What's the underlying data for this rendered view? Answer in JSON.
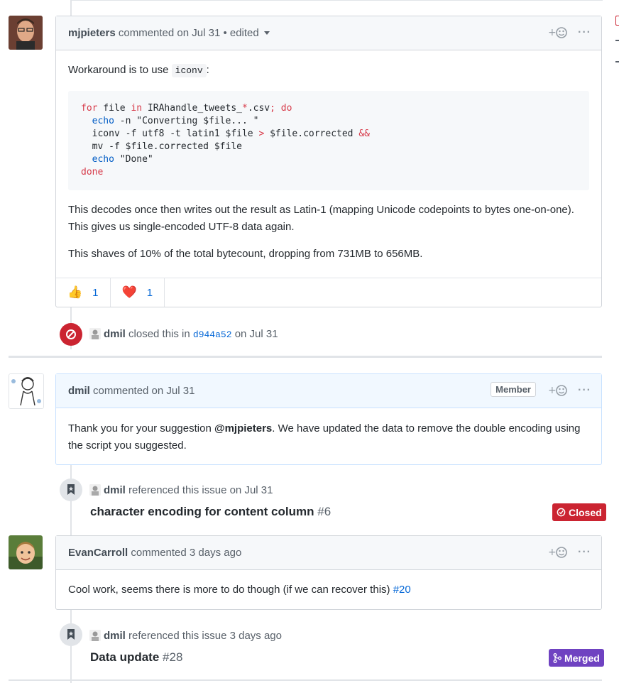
{
  "comments": [
    {
      "author": "mjpieters",
      "meta": "commented on Jul 31 • edited",
      "intro_prefix": "Workaround is to use ",
      "intro_code": "iconv",
      "intro_suffix": ":",
      "paragraph1": "This decodes once then writes out the result as Latin-1 (mapping Unicode codepoints to bytes one-on-one). This gives us single-encoded UTF-8 data again.",
      "paragraph2": "This shaves of 10% of the total bytecount, dropping from 731MB to 656MB.",
      "reactions": [
        {
          "emoji": "👍",
          "icon": "thumbs-up-icon",
          "count": "1"
        },
        {
          "emoji": "❤️",
          "icon": "heart-icon",
          "count": "1"
        }
      ]
    },
    {
      "author": "dmil",
      "meta": "commented on Jul 31",
      "role": "Member",
      "body_prefix": "Thank you for your suggestion ",
      "body_mention": "@mjpieters",
      "body_suffix": ". We have updated the data to remove the double encoding using the script you suggested."
    },
    {
      "author": "EvanCarroll",
      "meta": "commented 3 days ago",
      "body_prefix": "Cool work, seems there is more to do though (if we can recover this) ",
      "body_link": "#20"
    }
  ],
  "code_lines": {
    "l1_kw1": "for",
    "l1_mid": " file ",
    "l1_kw2": "in",
    "l1_rest": " IRAhandle_tweets_",
    "l1_star": "*",
    "l1_ext": ".csv",
    "l1_semi": ";",
    "l1_do": " do",
    "l2_cmd": "  echo",
    "l2_rest": " -n \"Converting $file... \"",
    "l3_rest": "  iconv -f utf8 -t latin1 $file ",
    "l3_gt": ">",
    "l3_mid": " $file.corrected ",
    "l3_and": "&&",
    "l4_rest": "  mv -f $file.corrected $file",
    "l5_cmd": "  echo",
    "l5_rest": " \"Done\"",
    "l6_done": "done"
  },
  "events": {
    "closed": {
      "actor": "dmil",
      "text_before": "closed this in",
      "commit": "d944a52",
      "text_after": "on Jul 31",
      "icon": "circle-slash-icon",
      "color": "#cb2431"
    },
    "ref1": {
      "actor": "dmil",
      "text": "referenced this issue on Jul 31",
      "title": "character encoding for content column",
      "number": "#6",
      "state": "Closed",
      "state_color": "#cb2431",
      "icon": "bookmark-icon"
    },
    "ref2": {
      "actor": "dmil",
      "text": "referenced this issue 3 days ago",
      "title": "Data update",
      "number": "#28",
      "state": "Merged",
      "state_color": "#6f42c1",
      "icon": "bookmark-icon"
    }
  }
}
